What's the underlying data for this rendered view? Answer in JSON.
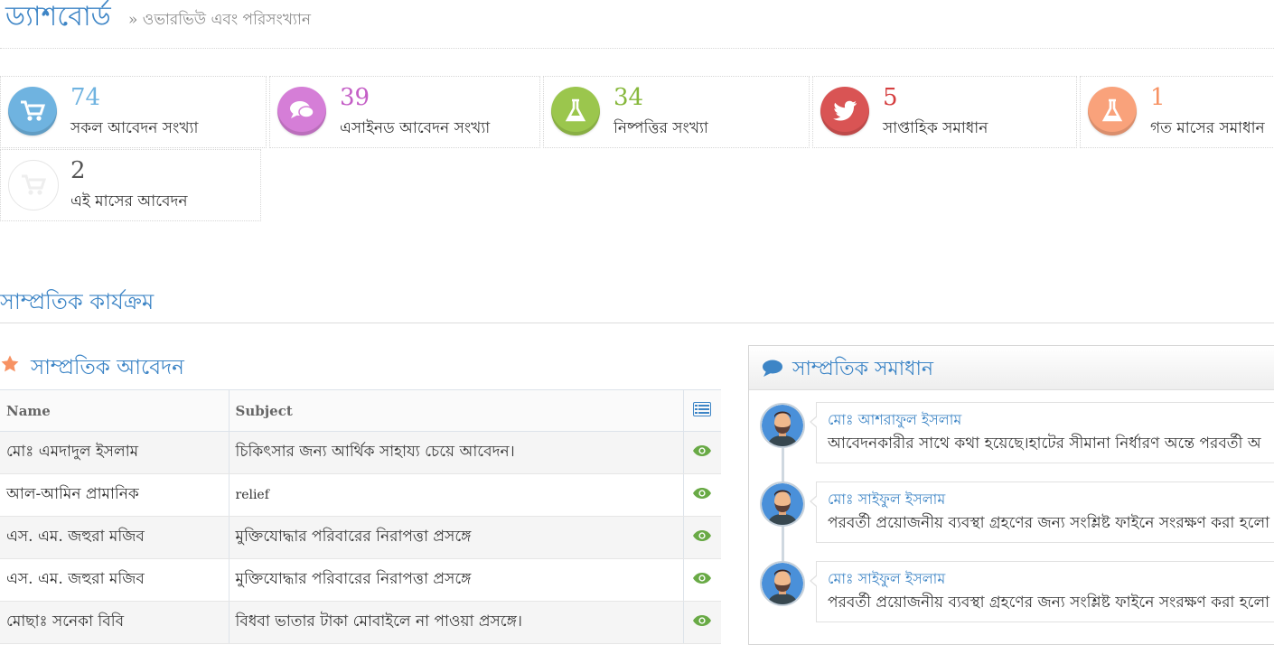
{
  "header": {
    "title": "ড্যাশবোর্ড",
    "subtitle": "» ওভারভিউ এবং পরিসংখ্যান"
  },
  "stats": [
    {
      "value": "74",
      "label": "সকল আবেদন সংখ্যা",
      "color": "#6fb3e0",
      "icon": "shopping-cart-icon"
    },
    {
      "value": "39",
      "label": "এসাইনড আবেদন সংখ্যা",
      "color": "#c45ec6",
      "icon": "comments-icon"
    },
    {
      "value": "34",
      "label": "নিষ্পত্তির সংখ্যা",
      "color": "#87b83c",
      "icon": "flask-icon"
    },
    {
      "value": "5",
      "label": "সাপ্তাহিক সমাধান",
      "color": "#d53f40",
      "icon": "twitter-icon"
    },
    {
      "value": "1",
      "label": "গত মাসের সমাধান",
      "color": "#f79263",
      "icon": "flask-icon"
    },
    {
      "value": "2",
      "label": "এই মাসের আবেদন",
      "color": "#555555",
      "icon": "shopping-cart-icon"
    }
  ],
  "section_title": "সাম্প্রতিক কার্যক্রম",
  "recent_applications": {
    "title": "সাম্প্রতিক আবেদন",
    "columns": [
      "Name",
      "Subject"
    ],
    "rows": [
      {
        "name": "মোঃ এমদাদুল ইসলাম",
        "subject": "চিকিৎসার জন্য আর্থিক সাহায্য চেয়ে আবেদন।"
      },
      {
        "name": "আল-আমিন প্রামানিক",
        "subject": "relief"
      },
      {
        "name": "এস. এম. জহুরা মজিব",
        "subject": "মুক্তিযোদ্ধার পরিবারের নিরাপত্তা প্রসঙ্গে"
      },
      {
        "name": "এস. এম. জহুরা মজিব",
        "subject": "মুক্তিযোদ্ধার পরিবারের নিরাপত্তা প্রসঙ্গে"
      },
      {
        "name": "মোছাঃ সনেকা বিবি",
        "subject": "বিধবা ভাতার টাকা মোবাইলে না পাওয়া প্রসঙ্গে।"
      }
    ]
  },
  "recent_solutions": {
    "title": "সাম্প্রতিক সমাধান",
    "items": [
      {
        "name": "মোঃ আশরাফুল ইসলাম",
        "text": "আবেদনকারীর সাথে কথা হয়েছে।হাটের সীমানা নির্ধারণ অন্তে পরবর্তী অ"
      },
      {
        "name": "মোঃ সাইফুল ইসলাম",
        "text": "পরবর্তী প্রয়োজনীয় ব্যবস্থা গ্রহণের জন্য সংশ্লিষ্ট ফাইনে সংরক্ষণ করা হলো"
      },
      {
        "name": "মোঃ সাইফুল ইসলাম",
        "text": "পরবর্তী প্রয়োজনীয় ব্যবস্থা গ্রহণের জন্য সংশ্লিষ্ট ফাইনে সংরক্ষণ করা হলো"
      }
    ]
  }
}
